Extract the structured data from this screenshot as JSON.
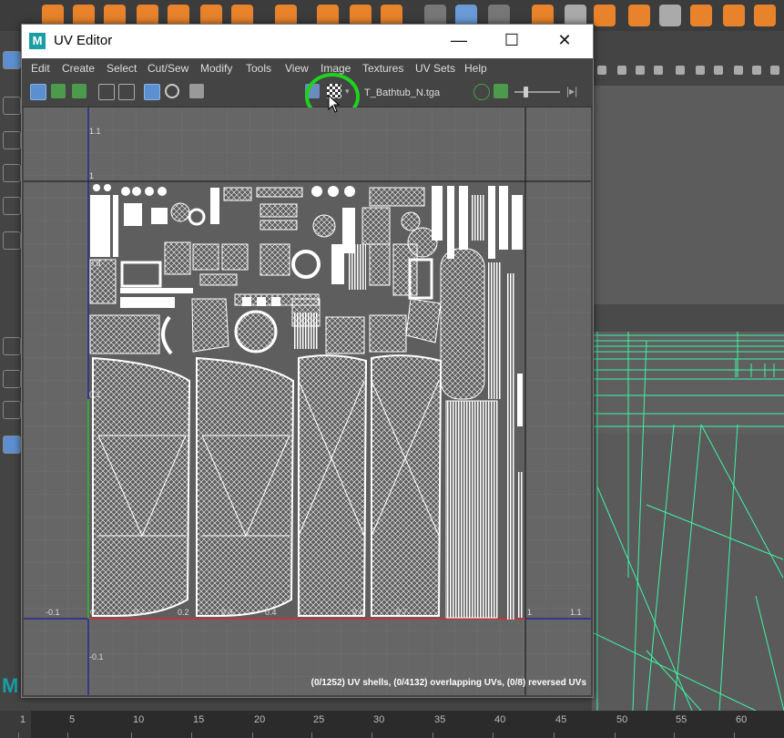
{
  "window": {
    "title": "UV Editor",
    "logo": "M",
    "controls": [
      "minimize-icon",
      "maximize-icon",
      "close-icon"
    ],
    "control_glyphs": [
      "—",
      "☐",
      "✕"
    ]
  },
  "menu": [
    "Edit",
    "Create",
    "Select",
    "Cut/Sew",
    "Modify",
    "Tools",
    "View",
    "Image",
    "Textures",
    "UV Sets",
    "Help"
  ],
  "toolbar": {
    "texture_name": "T_Bathtub_N.tga",
    "highlighted_button": "checker-display-icon",
    "highlight_color": "#1fd21f"
  },
  "uv_axes": {
    "bottom": [
      "-0.1",
      "0",
      "0.1",
      "0.2",
      "0.3",
      "0.4",
      "0.6",
      "0.7",
      "1",
      "1.1"
    ],
    "left": [
      "1.1",
      "1",
      "0.8",
      "0.1",
      "-0.1"
    ]
  },
  "status": "(0/1252) UV shells, (0/4132) overlapping UVs, (0/8) reversed UVs",
  "timeline": {
    "ticks": [
      "1",
      "5",
      "10",
      "15",
      "20",
      "25",
      "30",
      "35",
      "40",
      "45",
      "50",
      "55",
      "60"
    ]
  },
  "colors": {
    "wireframe": "#3cf5a3",
    "uv_u_axis": "#e03030",
    "uv_v_axis": "#30c030",
    "grid_line": "#1a1aa0"
  }
}
